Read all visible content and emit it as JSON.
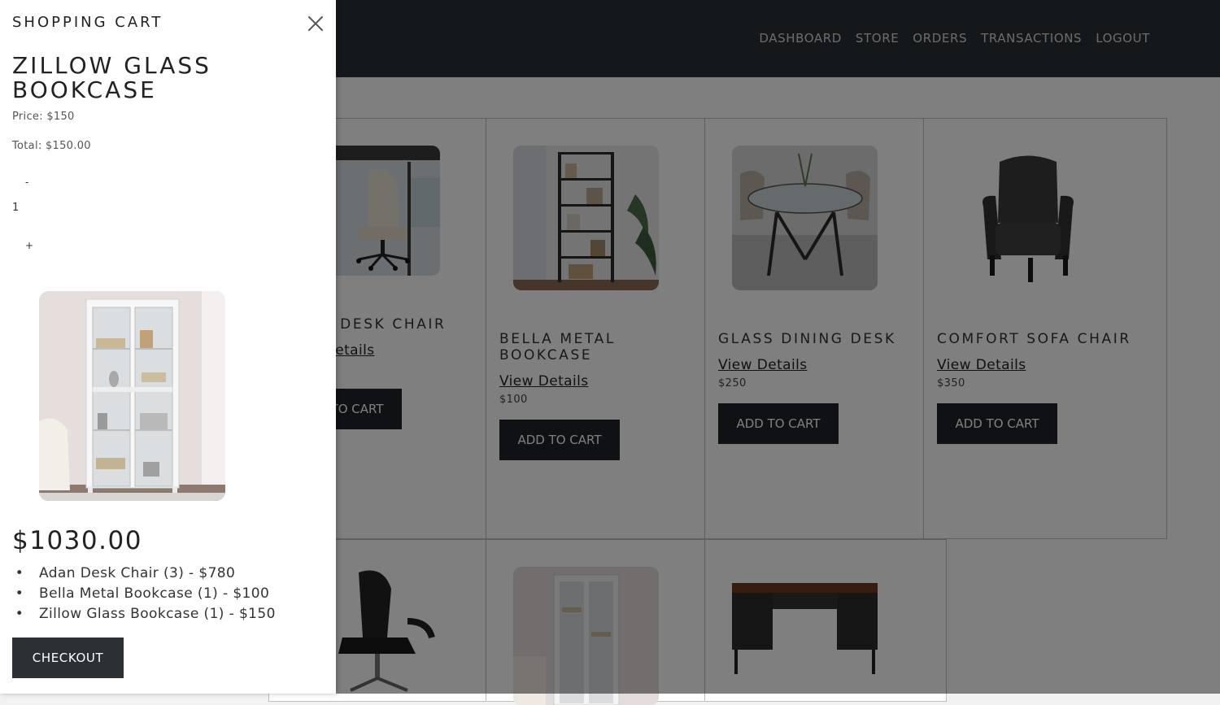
{
  "nav": {
    "items": [
      "DASHBOARD",
      "STORE",
      "ORDERS",
      "TRANSACTIONS",
      "LOGOUT"
    ]
  },
  "products": [
    {
      "name": "ADAN DESK CHAIR",
      "details": "View Details",
      "button": "ADD TO CART"
    },
    {
      "name": "BELLA METAL BOOKCASE",
      "details": "View Details",
      "price": "$100",
      "button": "ADD TO CART"
    },
    {
      "name": "GLASS DINING DESK",
      "details": "View Details",
      "price": "$250",
      "button": "ADD TO CART"
    },
    {
      "name": "COMFORT SOFA CHAIR",
      "details": "View Details",
      "price": "$350",
      "button": "ADD TO CART"
    }
  ],
  "cart": {
    "header": "SHOPPING CART",
    "product_title": "ZILLOW GLASS BOOKCASE",
    "price": "Price: $150",
    "total": "Total: $150.00",
    "decrement": "-",
    "quantity": "1",
    "increment": "+",
    "grand_total": "$1030.00",
    "items": [
      "Adan Desk Chair (3) - $780",
      "Bella Metal Bookcase (1) - $100",
      "Zillow Glass Bookcase (1) - $150"
    ],
    "checkout": "CHECKOUT"
  },
  "colors": {
    "topbar": "#2b3035",
    "button": "#1e2328",
    "overlay": "rgba(0,0,0,0.5)"
  }
}
